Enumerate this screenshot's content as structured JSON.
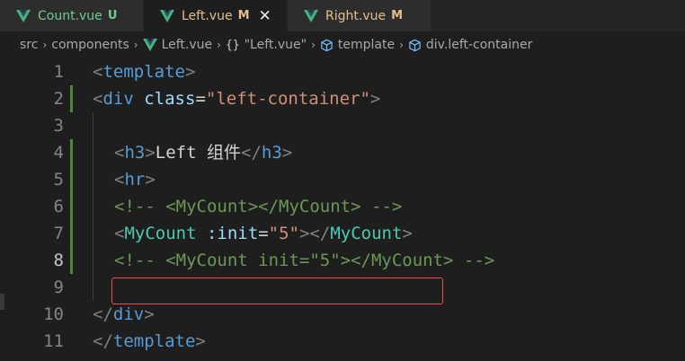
{
  "tabs": [
    {
      "label": "Count.vue",
      "status": "U",
      "active": false
    },
    {
      "label": "Left.vue",
      "status": "M",
      "active": true,
      "close": "✕"
    },
    {
      "label": "Right.vue",
      "status": "M",
      "active": false
    }
  ],
  "breadcrumb": {
    "src": "src",
    "components": "components",
    "file": "Left.vue",
    "braces": "{}",
    "scope": "\"Left.vue\"",
    "template": "template",
    "div": "div.left-container",
    "sep": "›"
  },
  "editor": {
    "line_numbers": [
      "1",
      "2",
      "3",
      "4",
      "5",
      "6",
      "7",
      "8",
      "9",
      "10",
      "11"
    ],
    "lines": {
      "l1": {
        "open": "<",
        "name": "template",
        "close": ">"
      },
      "l2": {
        "open": "<",
        "name": "div",
        "space": " ",
        "attr": "class",
        "eq": "=",
        "value": "\"left-container\"",
        "close": ">"
      },
      "l4": {
        "open": "<",
        "name": "h3",
        "close": ">",
        "text": "Left 组件",
        "endopen": "</",
        "endname": "h3",
        "endclose": ">"
      },
      "l5": {
        "open": "<",
        "name": "hr",
        "close": ">"
      },
      "l6": {
        "comment": "<!-- <MyCount></MyCount> -->"
      },
      "l7": {
        "open": "<",
        "name": "MyCount",
        "space": " ",
        "attr": ":init",
        "eq": "=",
        "value": "\"5\"",
        "close": ">",
        "endopen": "</",
        "endname": "MyCount",
        "endclose": ">"
      },
      "l8": {
        "comment": "<!-- <MyCount init=\"5\"></MyCount> -->"
      },
      "l10": {
        "open": "</",
        "name": "div",
        "close": ">"
      },
      "l11": {
        "open": "</",
        "name": "template",
        "close": ">"
      }
    }
  },
  "colors": {
    "vue_icon": "#41b883",
    "untracked": "#73c991",
    "modified": "#e2c08d",
    "highlight": "#f14c4c"
  }
}
